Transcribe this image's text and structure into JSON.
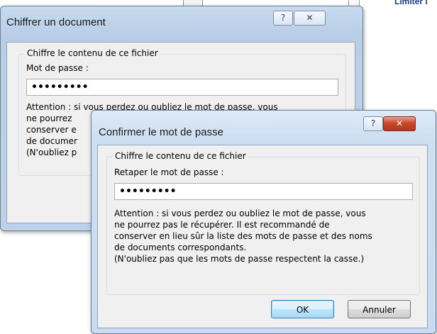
{
  "background": {
    "ribbon_text": "Limiter l"
  },
  "dialog_back": {
    "title": "Chiffrer un document",
    "help_glyph": "?",
    "close_glyph": "✕",
    "group_label": "Chiffre le contenu de ce fichier",
    "password_label": "Mot de passe :",
    "password_value": "•••••••••",
    "warning_text": "Attention : si vous perdez ou oubliez le mot de passe, vous\nne pourrez\nconserver e\nde documer\n(N'oubliez p"
  },
  "dialog_front": {
    "title": "Confirmer le mot de passe",
    "help_glyph": "?",
    "close_glyph": "✕",
    "group_label": "Chiffre le contenu de ce fichier",
    "password_label": "Retaper le mot de passe :",
    "password_value": "•••••••••",
    "warning_text": "Attention : si vous perdez ou oubliez le mot de passe, vous\nne pourrez pas le récupérer. Il est recommandé de\nconserver en lieu sûr la liste des mots de passe et des noms\nde documents correspondants.\n(N'oubliez pas que les mots de passe respectent la casse.)",
    "ok_label": "OK",
    "cancel_label": "Annuler"
  },
  "colors": {
    "dialog_frame": "#b9cfe7",
    "dialog_body": "#f0f0f0",
    "close_active": "#c9492c",
    "default_button_border": "#3c7fb1"
  }
}
